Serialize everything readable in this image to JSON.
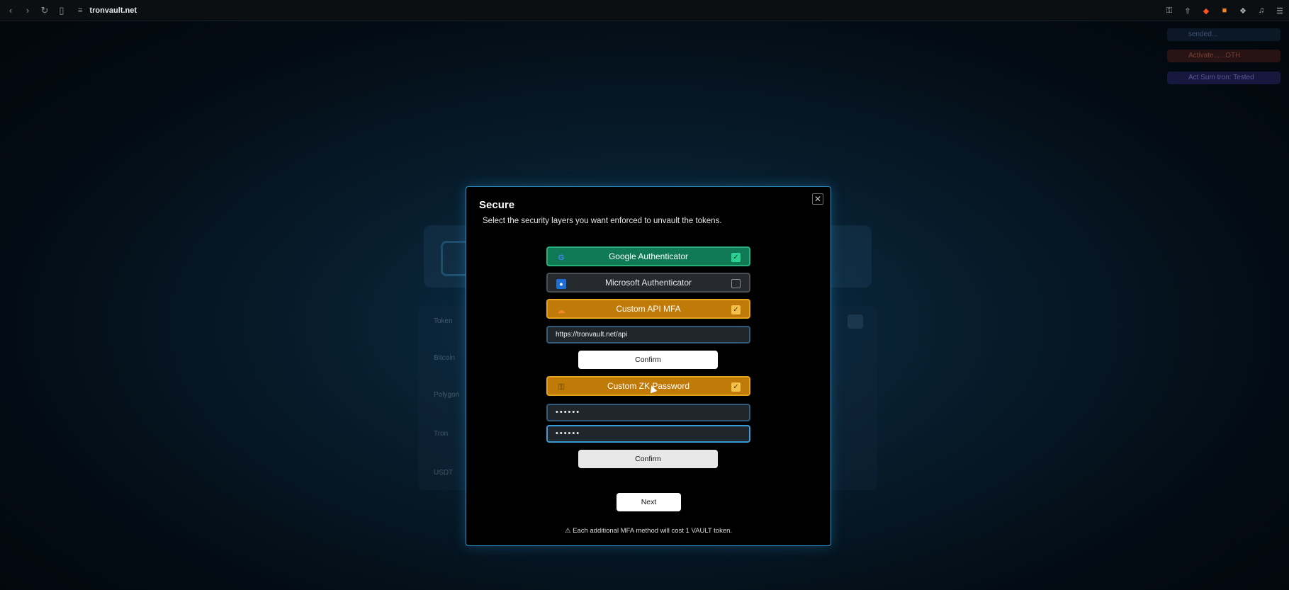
{
  "browser": {
    "url": "tronvault.net",
    "nav_icons": [
      "back-icon",
      "forward-icon",
      "reload-icon",
      "bookmark-icon"
    ],
    "right_icons": [
      "key-icon",
      "share-icon",
      "brave-shield-icon",
      "metamask-icon",
      "extensions-icon",
      "media-icon",
      "menu-icon"
    ]
  },
  "background_page": {
    "rows": [
      "Token",
      "Bitcoin",
      "Polygon",
      "Tron",
      "USDT"
    ],
    "toasts": [
      "sended... ",
      "Activate......OTH",
      "Act Sum tron: Tested"
    ]
  },
  "modal": {
    "title": "Secure",
    "subtitle": "Select the security layers you want enforced to unvault the tokens.",
    "close_icon": "close-icon",
    "options": [
      {
        "label": "Google Authenticator",
        "checked": true,
        "icon": "google-icon",
        "color": "#0f7a55"
      },
      {
        "label": "Microsoft Authenticator",
        "checked": false,
        "icon": "microsoft-authenticator-icon",
        "color": "#262a2e"
      },
      {
        "label": "Custom API MFA",
        "checked": true,
        "icon": "cloud-icon",
        "color": "#bf7a08"
      },
      {
        "label": "Custom ZK Password",
        "checked": true,
        "icon": "key-icon",
        "color": "#bf7a08"
      }
    ],
    "api_url_value": "https://tronvault.net/api",
    "password_value": "••••••",
    "password_confirm_value": "••••••",
    "confirm_label": "Confirm",
    "next_label": "Next",
    "footnote": "⚠ Each additional MFA method will cost 1 VAULT token."
  },
  "colors": {
    "accent_border": "#2b93c9",
    "green": "#0f7a55",
    "amber": "#bf7a08"
  }
}
